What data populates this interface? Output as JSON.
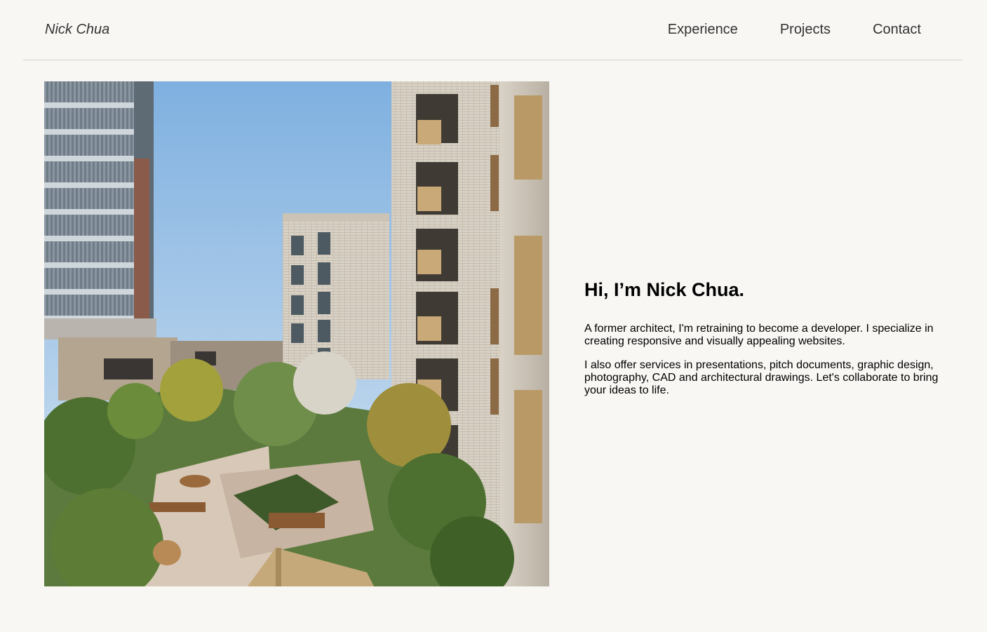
{
  "header": {
    "brand": "Nick Chua",
    "nav": [
      {
        "label": "Experience"
      },
      {
        "label": "Projects"
      },
      {
        "label": "Contact"
      }
    ]
  },
  "hero": {
    "image_alt": "Architectural rendering of a courtyard garden between apartment buildings"
  },
  "intro": {
    "heading": "Hi, I’m Nick Chua.",
    "paragraph_1": "A former architect, I'm retraining to become a developer. I specialize in creating responsive and visually appealing websites.",
    "paragraph_2": "I also offer services in presentations, pitch documents, graphic design, photography, CAD and architectural drawings. Let's collaborate to bring your ideas to life."
  },
  "colors": {
    "background": "#f8f7f4",
    "divider": "#d4d2cd",
    "text": "#111111"
  }
}
